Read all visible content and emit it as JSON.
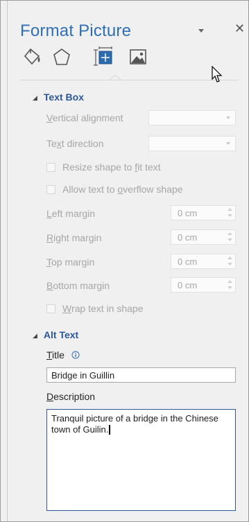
{
  "pane": {
    "title": "Format Picture",
    "tabs": [
      {
        "name": "fill-line",
        "icon": "paint-bucket-icon"
      },
      {
        "name": "effects",
        "icon": "pentagon-icon"
      },
      {
        "name": "size-properties",
        "icon": "size-properties-icon",
        "selected": true
      },
      {
        "name": "picture",
        "icon": "picture-icon"
      }
    ]
  },
  "text_box": {
    "heading": "Text Box",
    "vertical_alignment": {
      "pre": "",
      "u": "V",
      "post": "ertical alignment",
      "value": ""
    },
    "text_direction": {
      "pre": "Te",
      "u": "x",
      "post": "t direction",
      "value": ""
    },
    "resize_shape": {
      "pre": "Resize shape to ",
      "u": "f",
      "post": "it text"
    },
    "allow_overflow": {
      "pre": "Allow text to ",
      "u": "o",
      "post": "verflow shape"
    },
    "left_margin": {
      "pre": "",
      "u": "L",
      "post": "eft margin",
      "value": "0 cm"
    },
    "right_margin": {
      "pre": "",
      "u": "R",
      "post": "ight margin",
      "value": "0 cm"
    },
    "top_margin": {
      "pre": "",
      "u": "T",
      "post": "op margin",
      "value": "0 cm"
    },
    "bottom_margin": {
      "pre": "",
      "u": "B",
      "post": "ottom margin",
      "value": "0 cm"
    },
    "wrap_text": {
      "pre": "",
      "u": "W",
      "post": "rap text in shape"
    }
  },
  "alt_text": {
    "heading": "Alt Text",
    "title_label": {
      "u": "T",
      "post": "itle"
    },
    "title_value": "Bridge in Guillin",
    "description_label": {
      "u": "D",
      "post": "escription"
    },
    "description_value": "Tranquil picture of a bridge in the Chinese town of Guilin."
  },
  "colors": {
    "accent": "#2b579a",
    "title": "#2e6fb6",
    "disabled_text": "#a6a6a6",
    "pane_bg": "#f0f0f0"
  }
}
